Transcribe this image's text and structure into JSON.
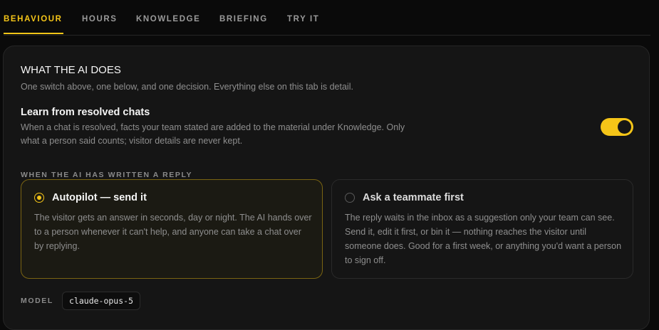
{
  "tabs": [
    {
      "label": "BEHAVIOUR",
      "active": true
    },
    {
      "label": "HOURS",
      "active": false
    },
    {
      "label": "KNOWLEDGE",
      "active": false
    },
    {
      "label": "BRIEFING",
      "active": false
    },
    {
      "label": "TRY IT",
      "active": false
    }
  ],
  "section": {
    "title": "WHAT THE AI DOES",
    "subtitle": "One switch above, one below, and one decision. Everything else on this tab is detail."
  },
  "learn": {
    "title": "Learn from resolved chats",
    "description": "When a chat is resolved, facts your team stated are added to the material under Knowledge. Only what a person said counts; visitor details are never kept.",
    "enabled": true
  },
  "reply_mode": {
    "label": "WHEN THE AI HAS WRITTEN A REPLY",
    "options": [
      {
        "title": "Autopilot — send it",
        "description": "The visitor gets an answer in seconds, day or night. The AI hands over to a person whenever it can't help, and anyone can take a chat over by replying.",
        "selected": true
      },
      {
        "title": "Ask a teammate first",
        "description": "The reply waits in the inbox as a suggestion only your team can see. Send it, edit it first, or bin it — nothing reaches the visitor until someone does. Good for a first week, or anything you'd want a person to sign off.",
        "selected": false
      }
    ]
  },
  "model": {
    "label": "MODEL",
    "value": "claude-opus-5"
  },
  "colors": {
    "accent": "#f5c518",
    "background": "#0a0a0a",
    "card": "#151515"
  }
}
